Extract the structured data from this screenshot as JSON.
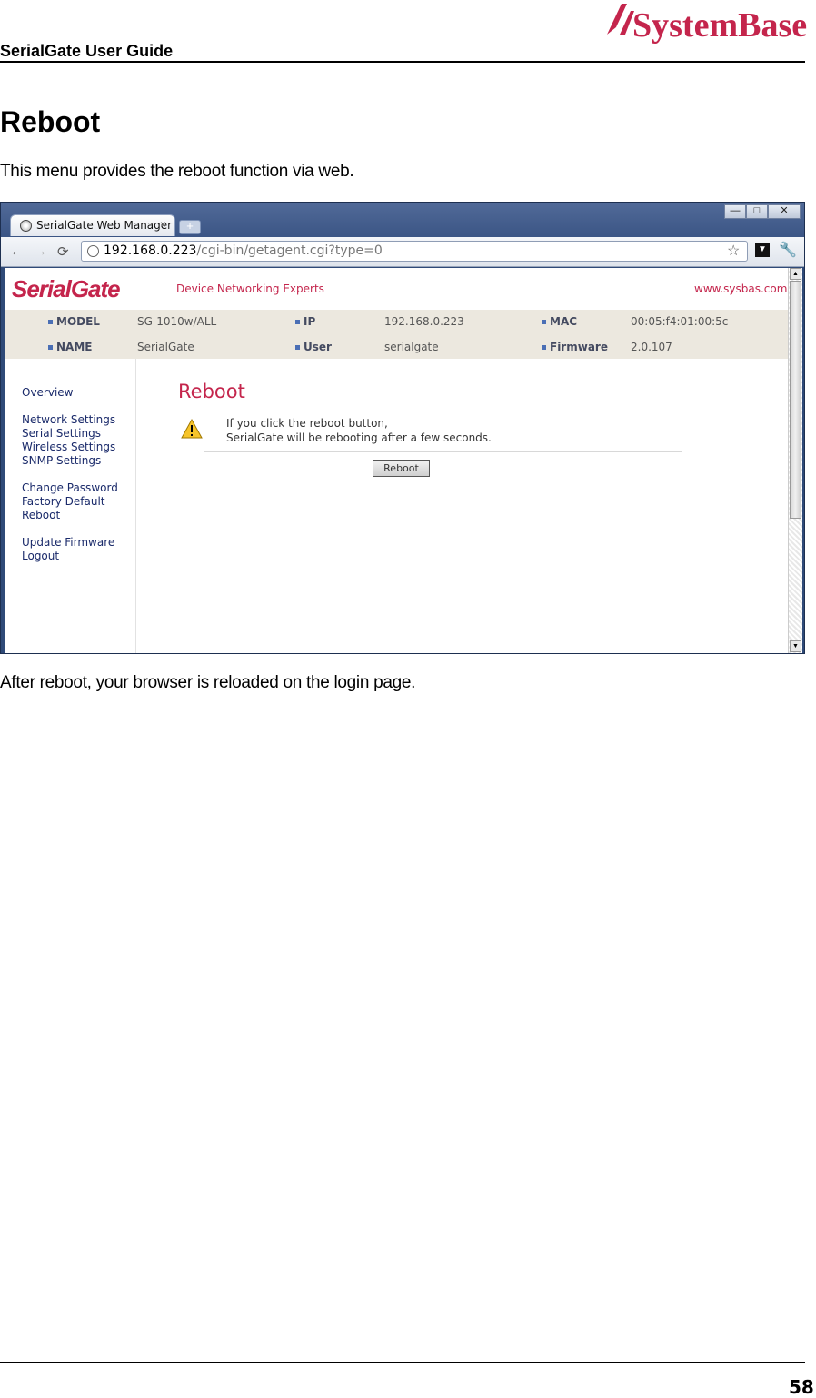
{
  "document": {
    "title": "SerialGate User Guide",
    "logo_text": "SystemBase",
    "section_heading": "Reboot",
    "intro": "This menu provides the reboot function via web.",
    "outro": "After reboot, your browser is reloaded on the login page.",
    "page_number": "58"
  },
  "browser": {
    "tab_title": "SerialGate Web Manager",
    "tab_close": "×",
    "new_tab": "+",
    "url_host": "192.168.0.223",
    "url_path": "/cgi-bin/getagent.cgi?type=0",
    "icons": [
      "back-icon",
      "forward-icon",
      "reload-icon",
      "globe-icon",
      "star-icon",
      "page-menu-icon",
      "wrench-icon"
    ]
  },
  "app": {
    "logo": "SerialGate",
    "tagline": "Device Networking Experts",
    "site_link": "www.sysbas.com",
    "info": [
      {
        "label": "MODEL",
        "value": "SG-1010w/ALL"
      },
      {
        "label": "IP",
        "value": "192.168.0.223"
      },
      {
        "label": "MAC",
        "value": "00:05:f4:01:00:5c"
      },
      {
        "label": "NAME",
        "value": "SerialGate"
      },
      {
        "label": "User",
        "value": "serialgate"
      },
      {
        "label": "Firmware",
        "value": "2.0.107"
      }
    ],
    "menu": [
      "Overview",
      "Network Settings",
      "Serial Settings",
      "Wireless Settings",
      "SNMP Settings",
      "Change Password",
      "Factory Default",
      "Reboot",
      "Update Firmware",
      "Logout"
    ],
    "content_title": "Reboot",
    "message_line1": "If you click the reboot button,",
    "message_line2": "SerialGate will be rebooting after a few seconds.",
    "reboot_button": "Reboot",
    "accent_color": "#c4254c"
  }
}
